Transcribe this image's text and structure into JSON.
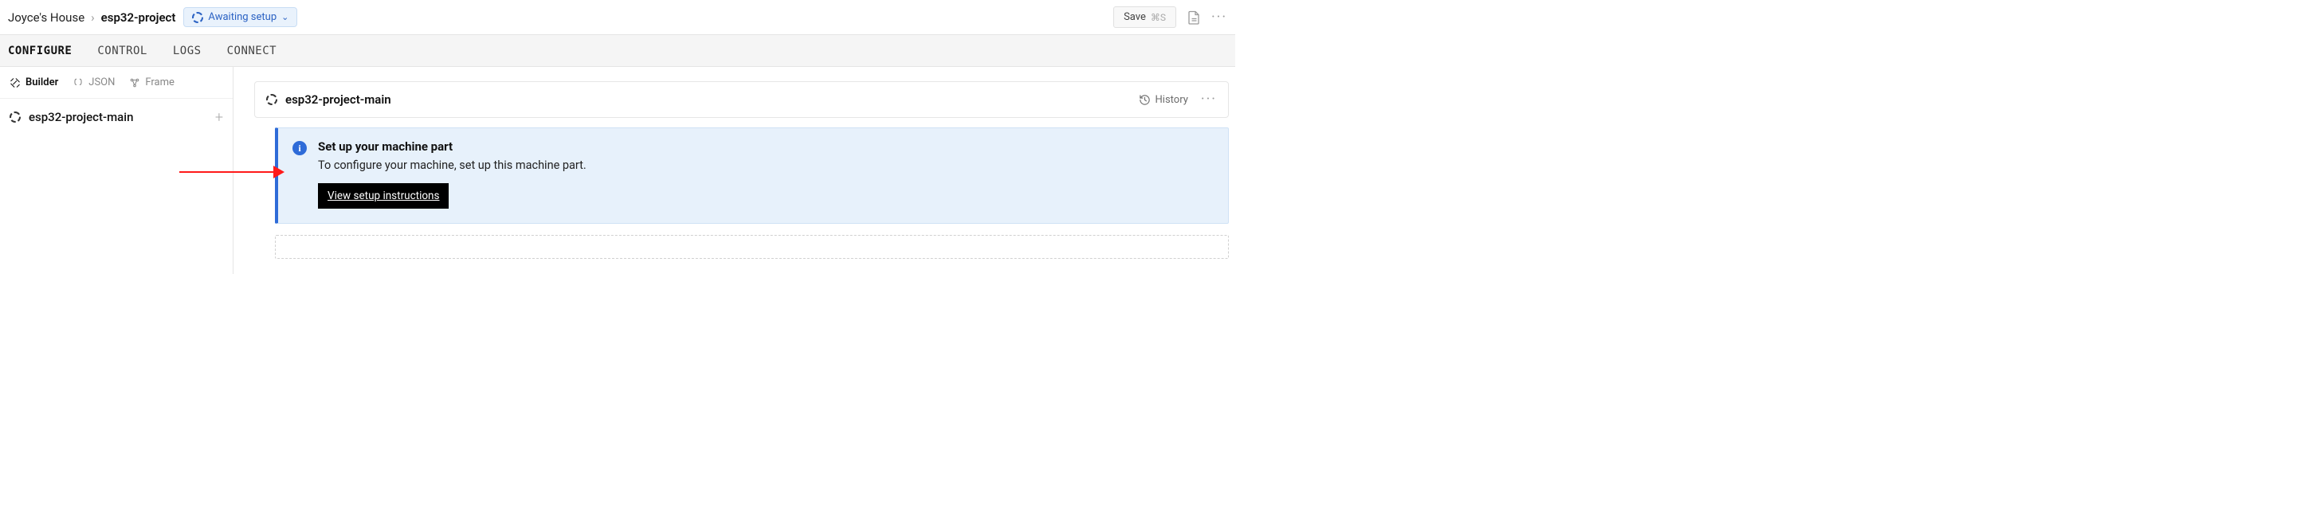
{
  "breadcrumb": {
    "location": "Joyce's House",
    "project": "esp32-project"
  },
  "status": {
    "label": "Awaiting setup"
  },
  "save": {
    "label": "Save",
    "shortcut": "⌘S"
  },
  "tabs": {
    "configure": "CONFIGURE",
    "control": "CONTROL",
    "logs": "LOGS",
    "connect": "CONNECT"
  },
  "side_tabs": {
    "builder": "Builder",
    "json": "JSON",
    "frame": "Frame"
  },
  "sidebar": {
    "project": "esp32-project-main"
  },
  "panel": {
    "title": "esp32-project-main",
    "history": "History"
  },
  "banner": {
    "title": "Set up your machine part",
    "text": "To configure your machine, set up this machine part.",
    "cta": "View setup instructions"
  }
}
